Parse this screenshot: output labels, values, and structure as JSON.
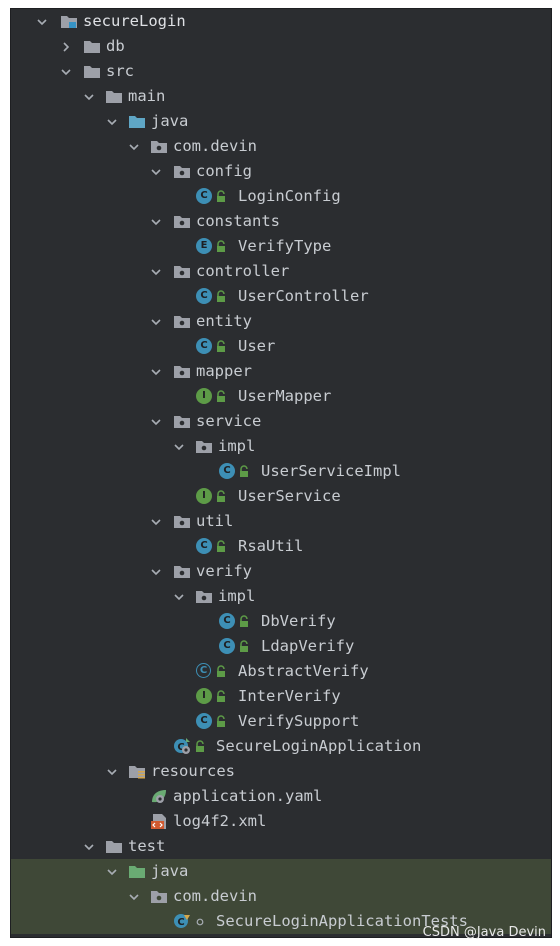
{
  "tree": {
    "root": "secureLogin",
    "db": "db",
    "src": "src",
    "main": "main",
    "java": "java",
    "com_devin": "com.devin",
    "config": "config",
    "login_config": "LoginConfig",
    "constants": "constants",
    "verify_type": "VerifyType",
    "controller": "controller",
    "user_controller": "UserController",
    "entity": "entity",
    "user": "User",
    "mapper": "mapper",
    "user_mapper": "UserMapper",
    "service": "service",
    "service_impl": "impl",
    "user_service_impl": "UserServiceImpl",
    "user_service": "UserService",
    "util": "util",
    "rsa_util": "RsaUtil",
    "verify": "verify",
    "verify_impl": "impl",
    "db_verify": "DbVerify",
    "ldap_verify": "LdapVerify",
    "abstract_verify": "AbstractVerify",
    "inter_verify": "InterVerify",
    "verify_support": "VerifySupport",
    "secure_login_application": "SecureLoginApplication",
    "resources": "resources",
    "application_yaml": "application.yaml",
    "log4f2_xml": "log4f2.xml",
    "test": "test",
    "test_java": "java",
    "test_com_devin": "com.devin",
    "secure_login_application_tests": "SecureLoginApplicationTests"
  },
  "badges": {
    "class": "C",
    "enum": "E",
    "interface": "I"
  },
  "watermark": "CSDN @Java Devin",
  "colors": {
    "background": "#2b2d30",
    "folder": "#9da0a8",
    "source_folder": "#5fa6c5",
    "test_folder": "#6aab73",
    "class_badge": "#3d8fb5",
    "interface_badge": "#5d9b47",
    "highlight": "#3f4837"
  }
}
